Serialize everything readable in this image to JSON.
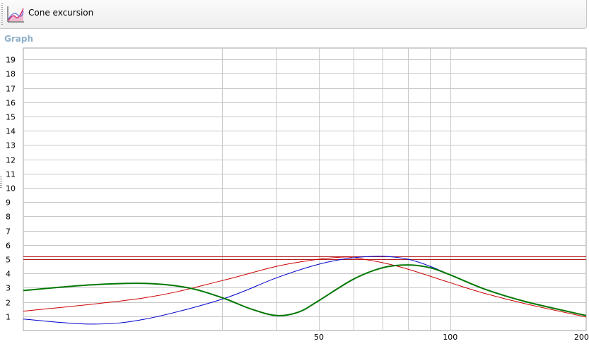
{
  "window": {
    "tab_title": "Cone excursion",
    "tab_icon": "graph-icon",
    "section_label": "Graph"
  },
  "chart_data": {
    "type": "line",
    "title": "",
    "xlabel": "",
    "ylabel": "",
    "x_scale": "log",
    "xlim": [
      10.5,
      205
    ],
    "ylim": [
      0,
      19.8
    ],
    "grid": true,
    "x_ticks": [
      50,
      100,
      200
    ],
    "x_gridlines": [
      30,
      40,
      50,
      60,
      70,
      80,
      90,
      100
    ],
    "y_ticks": [
      1,
      2,
      3,
      4,
      5,
      6,
      7,
      8,
      9,
      10,
      11,
      12,
      13,
      14,
      15,
      16,
      17,
      18,
      19
    ],
    "reference_lines": [
      {
        "y": 5.2,
        "color": "#b22222"
      },
      {
        "y": 5.0,
        "color": "#b22222"
      }
    ],
    "series": [
      {
        "color": "#cc0000",
        "x": [
          10.5,
          20,
          30,
          40,
          50,
          57,
          60,
          70,
          80,
          100,
          120,
          150,
          205
        ],
        "y": [
          1.35,
          2.3,
          3.5,
          4.5,
          5.0,
          5.15,
          5.1,
          4.75,
          4.3,
          3.35,
          2.6,
          1.85,
          0.95
        ]
      },
      {
        "color": "#0000cc",
        "x": [
          10.5,
          15,
          20,
          30,
          40,
          50,
          60,
          70,
          80,
          90,
          100,
          120,
          150,
          205
        ],
        "y": [
          0.8,
          0.45,
          0.8,
          2.2,
          3.7,
          4.65,
          5.1,
          5.2,
          5.0,
          4.5,
          3.9,
          2.9,
          2.0,
          1.05
        ]
      },
      {
        "color": "#007700",
        "x": [
          10.5,
          15,
          20,
          25,
          30,
          35,
          40,
          45,
          50,
          60,
          70,
          80,
          90,
          100,
          120,
          150,
          205
        ],
        "y": [
          2.8,
          3.2,
          3.3,
          3.0,
          2.3,
          1.5,
          1.05,
          1.3,
          2.1,
          3.6,
          4.4,
          4.6,
          4.4,
          3.9,
          2.9,
          2.0,
          1.05
        ]
      }
    ]
  }
}
